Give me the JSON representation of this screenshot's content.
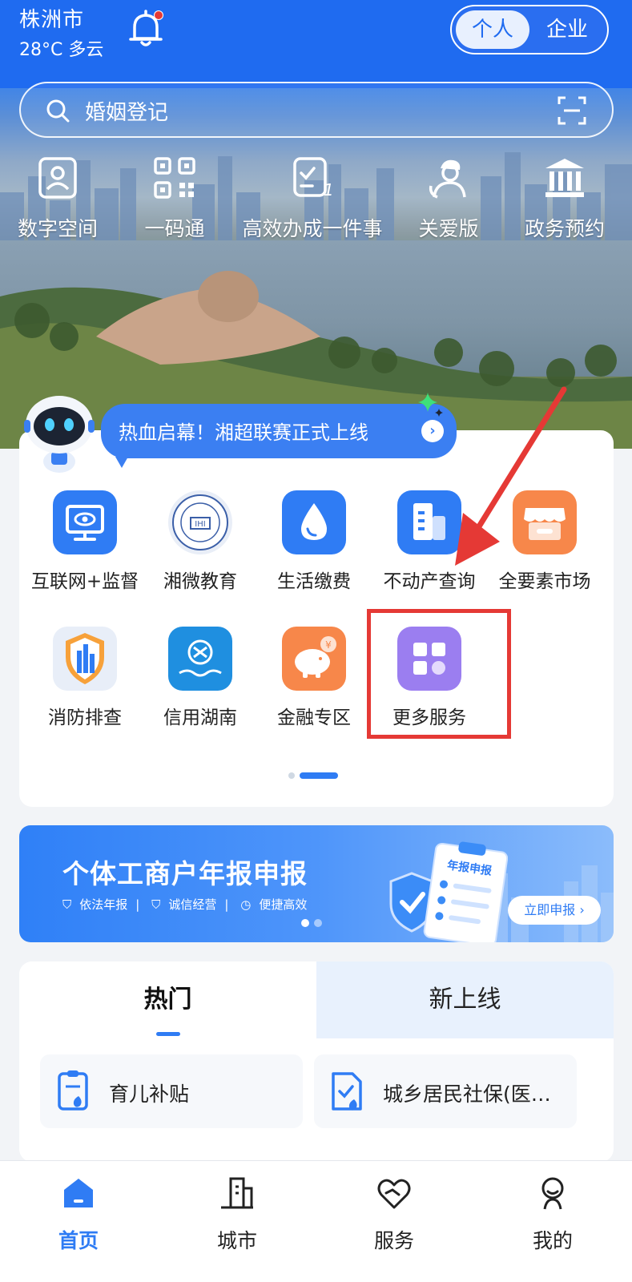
{
  "header": {
    "city": "株洲市",
    "weather": "28°C 多云",
    "mode_toggle": {
      "personal": "个人",
      "enterprise": "企业",
      "selected": "个人"
    }
  },
  "search": {
    "text": "婚姻登记"
  },
  "quick_actions": [
    {
      "label": "数字空间",
      "icon": "person-badge-icon"
    },
    {
      "label": "一码通",
      "icon": "qr-code-icon"
    },
    {
      "label": "高效办成一件事",
      "icon": "checklist-icon"
    },
    {
      "label": "关爱版",
      "icon": "care-person-icon"
    },
    {
      "label": "政务预约",
      "icon": "government-building-icon"
    }
  ],
  "announcement": {
    "text": "热血启幕！湘超联赛正式上线"
  },
  "services": [
    {
      "label": "互联网+监督",
      "icon": "monitor-eye-icon",
      "color": "#2f7cf4"
    },
    {
      "label": "湘微教育",
      "icon": "school-seal-icon",
      "color": "#e9eef7"
    },
    {
      "label": "生活缴费",
      "icon": "water-drop-icon",
      "color": "#2f7cf4"
    },
    {
      "label": "不动产查询",
      "icon": "building-icon",
      "color": "#2f7cf4"
    },
    {
      "label": "全要素市场",
      "icon": "store-icon",
      "color": "#f7874a"
    },
    {
      "label": "消防排查",
      "icon": "fire-shield-icon",
      "color": "#e8eef8"
    },
    {
      "label": "信用湖南",
      "icon": "credit-hunan-icon",
      "color": "#1f8fe0"
    },
    {
      "label": "金融专区",
      "icon": "piggy-bank-icon",
      "color": "#f7874a"
    },
    {
      "label": "更多服务",
      "icon": "grid-more-icon",
      "color": "#9b7ef0"
    }
  ],
  "banner": {
    "title": "个体工商户年报申报",
    "tags": [
      "依法年报",
      "诚信经营",
      "便捷高效"
    ],
    "board_label": "年报申报",
    "button": "立即申报"
  },
  "tabs": {
    "hot": "热门",
    "new": "新上线",
    "selected": "热门"
  },
  "hot_items": [
    {
      "label": "育儿补贴",
      "icon": "document-icon"
    },
    {
      "label": "城乡居民社保(医…",
      "icon": "document-check-icon"
    }
  ],
  "bottom_nav": [
    {
      "label": "首页",
      "icon": "home-icon",
      "active": true
    },
    {
      "label": "城市",
      "icon": "city-icon",
      "active": false
    },
    {
      "label": "服务",
      "icon": "heart-hands-icon",
      "active": false
    },
    {
      "label": "我的",
      "icon": "user-icon",
      "active": false
    }
  ],
  "colors": {
    "primary": "#2f7cf4",
    "header": "#1f6bf0",
    "highlight": "#e53935"
  }
}
